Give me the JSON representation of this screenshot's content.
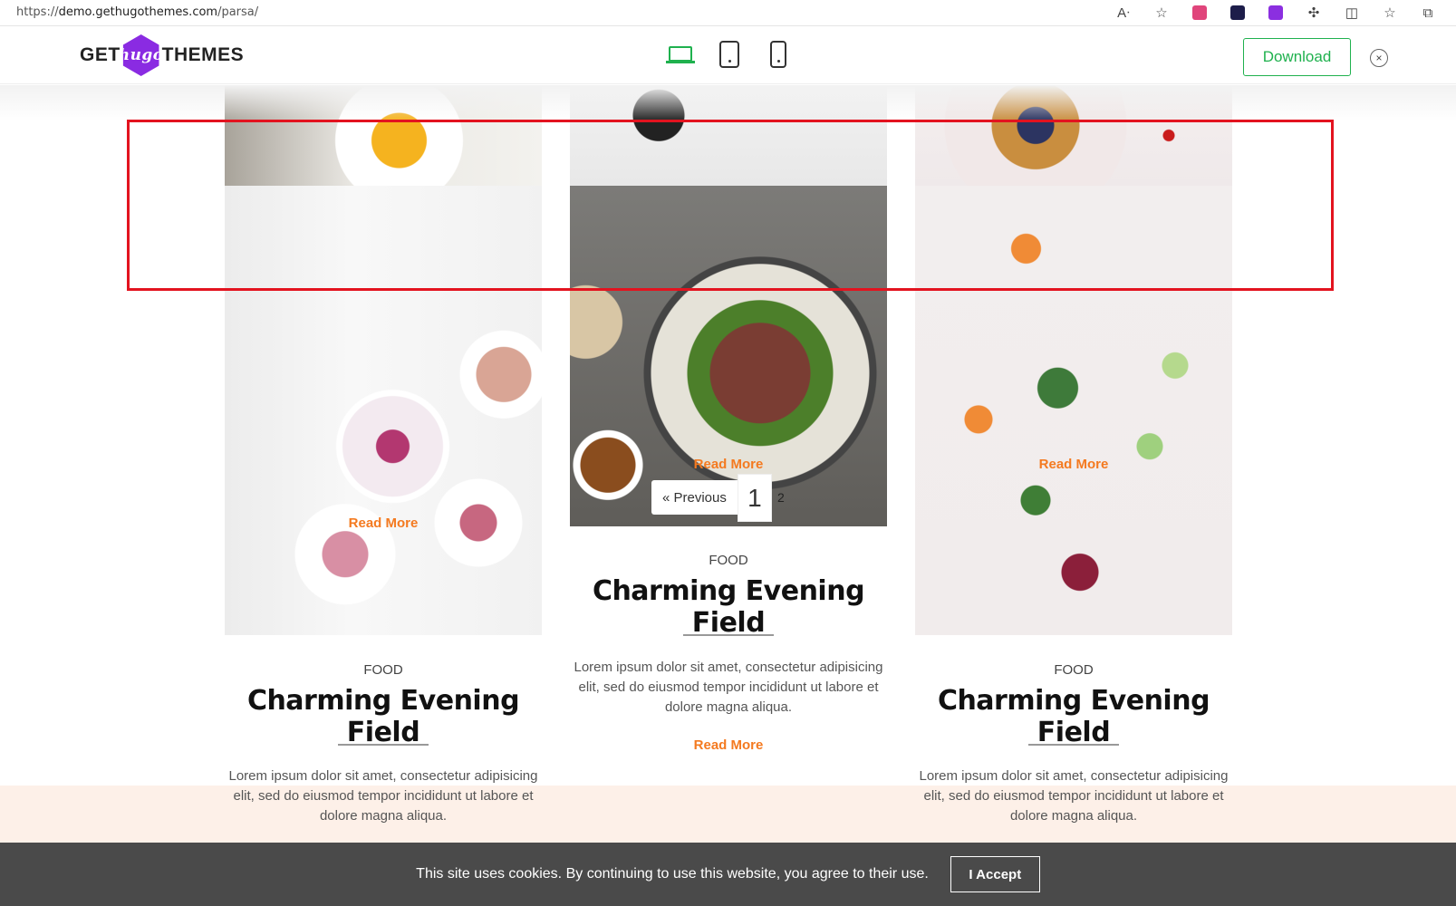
{
  "browser": {
    "url_scheme": "https://",
    "url_host": "demo.gethugothemes.com",
    "url_path": "/parsa/",
    "icons": [
      "read-aloud-icon",
      "favorite-star-icon",
      "extension-icon",
      "extension-icon",
      "extension-icon",
      "extensions-puzzle-icon",
      "split-screen-icon",
      "favorites-icon",
      "collections-icon"
    ]
  },
  "header": {
    "logo_left": "GET",
    "logo_middle": "hugo",
    "logo_right": "THEMES",
    "download_label": "Download",
    "close_symbol": "×",
    "accent_color": "#1fb14e"
  },
  "cards": [
    {
      "overlay_read_more": "Read More",
      "category": "FOOD",
      "title": "Charming Evening Field",
      "excerpt": "Lorem ipsum dolor sit amet, consectetur adipisicing elit, sed do eiusmod tempor incididunt ut labore et dolore magna aliqua."
    },
    {
      "overlay_read_more": "Read More",
      "category": "FOOD",
      "title": "Charming Evening Field",
      "excerpt": "Lorem ipsum dolor sit amet, consectetur adipisicing elit, sed do eiusmod tempor incididunt ut labore et dolore magna aliqua.",
      "read_more": "Read More"
    },
    {
      "overlay_read_more": "Read More",
      "category": "FOOD",
      "title": "Charming Evening Field",
      "excerpt": "Lorem ipsum dolor sit amet, consectetur adipisicing elit, sed do eiusmod tempor incididunt ut labore et dolore magna aliqua."
    }
  ],
  "pagination": {
    "previous": "« Previous",
    "current": "1",
    "next_page": "2"
  },
  "cookie": {
    "message": "This site uses cookies. By continuing to use this website, you agree to their use.",
    "accept_label": "I Accept"
  },
  "colors": {
    "link_orange": "#f47a20",
    "highlight_red": "#e3131f",
    "cookie_bg": "#4a4a4a"
  }
}
